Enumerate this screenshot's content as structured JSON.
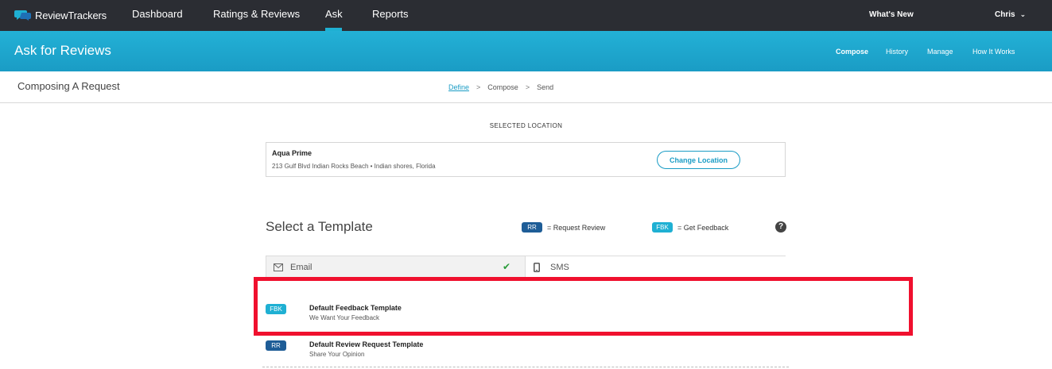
{
  "topnav": {
    "brand": "ReviewTrackers",
    "items": [
      {
        "label": "Dashboard"
      },
      {
        "label": "Ratings & Reviews"
      },
      {
        "label": "Ask"
      },
      {
        "label": "Reports"
      }
    ],
    "active_index": 2,
    "whats_new": "What's New",
    "user": "Chris"
  },
  "banner": {
    "title": "Ask for Reviews",
    "links": [
      {
        "label": "Compose"
      },
      {
        "label": "History"
      },
      {
        "label": "Manage"
      },
      {
        "label": "How It Works"
      }
    ],
    "active_index": 0
  },
  "compose": {
    "title": "Composing A Request",
    "steps": [
      {
        "label": "Define"
      },
      {
        "label": "Compose"
      },
      {
        "label": "Send"
      }
    ],
    "step_separator": ">",
    "active_step": 0
  },
  "location": {
    "section_label": "SELECTED LOCATION",
    "name": "Aqua Prime",
    "address": "213 Gulf Blvd Indian Rocks Beach • Indian shores, Florida",
    "change_button": "Change Location"
  },
  "template": {
    "title": "Select a Template",
    "legend": [
      {
        "badge": "RR",
        "text": "= Request Review"
      },
      {
        "badge": "FBK",
        "text": "= Get Feedback"
      }
    ],
    "help_glyph": "?",
    "tabs": [
      {
        "label": "Email",
        "icon": "envelope-icon",
        "selected": true
      },
      {
        "label": "SMS",
        "icon": "mobile-phone-icon",
        "selected": false
      }
    ],
    "check_glyph": "✔",
    "items": [
      {
        "badge": "FBK",
        "name": "Default Feedback Template",
        "subtitle": "We Want Your Feedback"
      },
      {
        "badge": "RR",
        "name": "Default Review Request Template",
        "subtitle": "Share Your Opinion"
      }
    ]
  },
  "colors": {
    "nav_bg": "#2b2d33",
    "accent": "#1fb0d3",
    "rr_badge": "#1e5d97",
    "highlight": "#f0102e",
    "check": "#2a9d3a"
  }
}
